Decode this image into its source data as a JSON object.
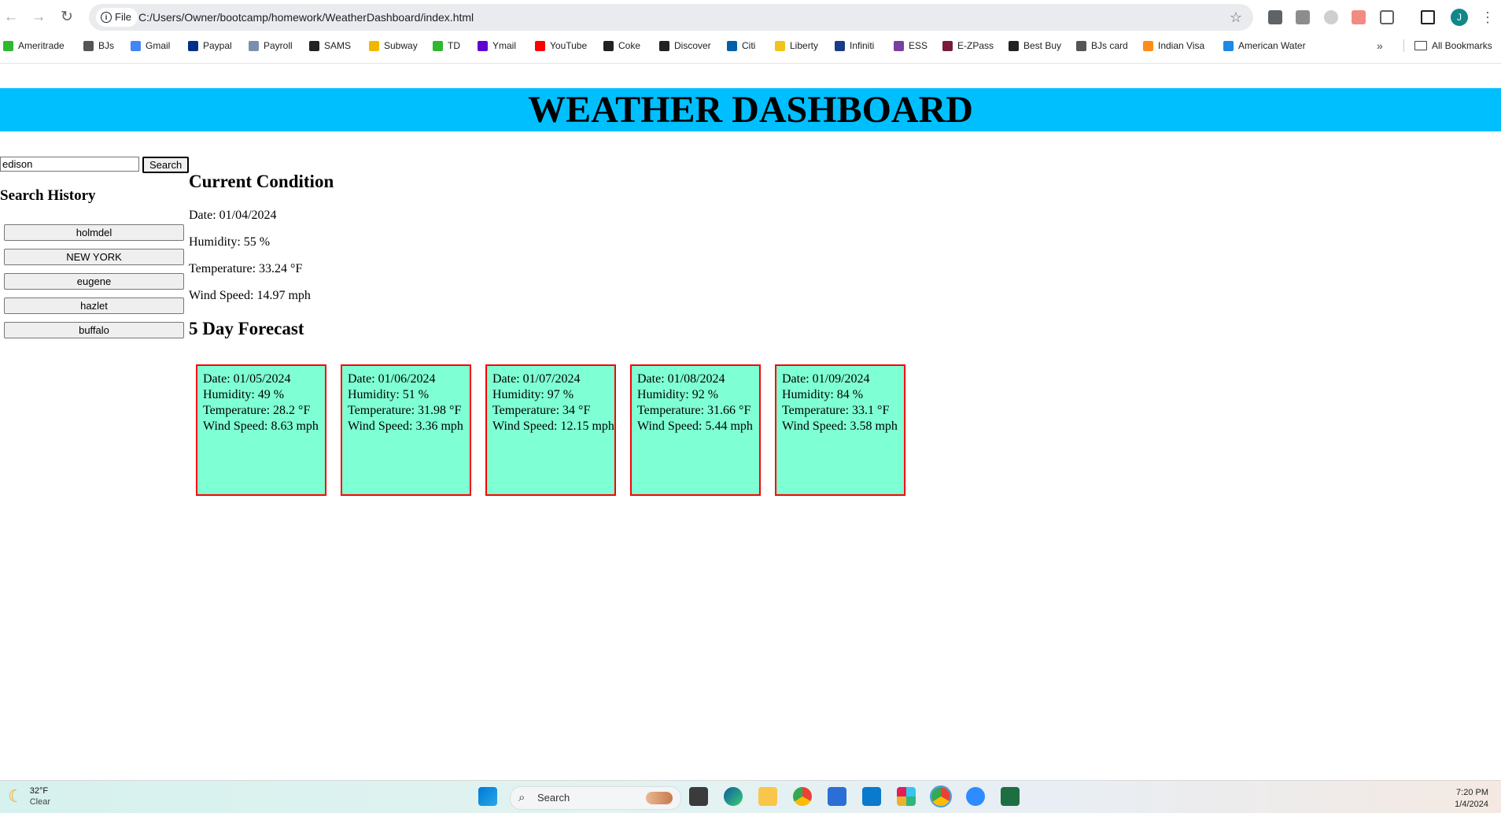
{
  "browser": {
    "site_chip": "File",
    "url": "C:/Users/Owner/bootcamp/homework/WeatherDashboard/index.html",
    "profile_initial": "J",
    "bookmarks": [
      {
        "label": "Ameritrade",
        "color": "#2eb82e"
      },
      {
        "label": "BJs",
        "color": "#555555"
      },
      {
        "label": "Gmail",
        "color": "#4285f4"
      },
      {
        "label": "Paypal",
        "color": "#003087"
      },
      {
        "label": "Payroll",
        "color": "#7a8fb0"
      },
      {
        "label": "SAMS",
        "color": "#222222"
      },
      {
        "label": "Subway",
        "color": "#f2b700"
      },
      {
        "label": "TD",
        "color": "#2eb82e"
      },
      {
        "label": "Ymail",
        "color": "#6001d2"
      },
      {
        "label": "YouTube",
        "color": "#ff0000"
      },
      {
        "label": "Coke",
        "color": "#222222"
      },
      {
        "label": "Discover",
        "color": "#222222"
      },
      {
        "label": "Citi",
        "color": "#0060a9"
      },
      {
        "label": "Liberty",
        "color": "#f0c419"
      },
      {
        "label": "Infiniti",
        "color": "#1a3a8a"
      },
      {
        "label": "ESS",
        "color": "#7b3fa0"
      },
      {
        "label": "E-ZPass",
        "color": "#7a1a3a"
      },
      {
        "label": "Best Buy",
        "color": "#222222"
      },
      {
        "label": "BJs card",
        "color": "#555555"
      },
      {
        "label": "Indian Visa",
        "color": "#ff8c1a"
      },
      {
        "label": "American Water",
        "color": "#1e88e5"
      }
    ],
    "bookmarks_more": "»",
    "all_bookmarks": "All Bookmarks"
  },
  "header": {
    "title": "WEATHER DASHBOARD"
  },
  "search": {
    "value": "edison",
    "button_label": "Search"
  },
  "history": {
    "title": "Search History",
    "items": [
      "holmdel",
      "NEW YORK",
      "eugene",
      "hazlet",
      "buffalo"
    ]
  },
  "current": {
    "title": "Current Condition",
    "date": "Date: 01/04/2024",
    "humidity": "Humidity: 55 %",
    "temperature": "Temperature: 33.24 °F",
    "wind": "Wind Speed: 14.97 mph"
  },
  "forecast": {
    "title": "5 Day Forecast",
    "days": [
      {
        "date": "Date: 01/05/2024",
        "humidity": "Humidity: 49 %",
        "temperature": "Temperature: 28.2 °F",
        "wind": "Wind Speed: 8.63 mph"
      },
      {
        "date": "Date: 01/06/2024",
        "humidity": "Humidity: 51 %",
        "temperature": "Temperature: 31.98 °F",
        "wind": "Wind Speed: 3.36 mph"
      },
      {
        "date": "Date: 01/07/2024",
        "humidity": "Humidity: 97 %",
        "temperature": "Temperature: 34 °F",
        "wind": "Wind Speed: 12.15 mph"
      },
      {
        "date": "Date: 01/08/2024",
        "humidity": "Humidity: 92 %",
        "temperature": "Temperature: 31.66 °F",
        "wind": "Wind Speed: 5.44 mph"
      },
      {
        "date": "Date: 01/09/2024",
        "humidity": "Humidity: 84 %",
        "temperature": "Temperature: 33.1 °F",
        "wind": "Wind Speed: 3.58 mph"
      }
    ]
  },
  "taskbar": {
    "weather_temp": "32°F",
    "weather_cond": "Clear",
    "search_label": "Search",
    "time": "7:20 PM",
    "date": "1/4/2024"
  }
}
